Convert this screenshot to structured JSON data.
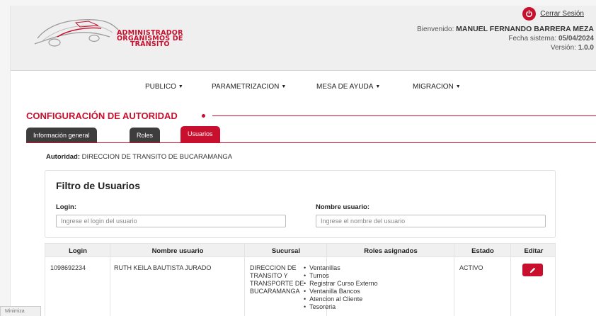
{
  "logo": {
    "line1": "ADMINISTRADOR",
    "line2": "ORGANISMOS DE",
    "line3": "TRÁNSITO",
    "icon": "car-logo-icon"
  },
  "user": {
    "logout_label": "Cerrar Sesión",
    "welcome_label": "Bienvenido:",
    "welcome_name": "MANUEL FERNANDO BARRERA MEZA",
    "date_label": "Fecha sistema:",
    "date_value": "05/04/2024",
    "version_label": "Versión:",
    "version_value": "1.0.0"
  },
  "nav": {
    "items": [
      {
        "label": "PUBLICO"
      },
      {
        "label": "PARAMETRIZACION"
      },
      {
        "label": "MESA DE AYUDA"
      },
      {
        "label": "MIGRACION"
      }
    ]
  },
  "section_title": "CONFIGURACIÓN DE AUTORIDAD",
  "tabs": [
    {
      "label": "Información general",
      "active": false
    },
    {
      "label": "Roles",
      "active": false
    },
    {
      "label": "Usuarios",
      "active": true
    }
  ],
  "autoridad": {
    "label": "Autoridad:",
    "value": "DIRECCION DE TRANSITO DE BUCARAMANGA"
  },
  "filter": {
    "title": "Filtro de Usuarios",
    "login_label": "Login:",
    "login_placeholder": "Ingrese el login del usuario",
    "login_value": "",
    "name_label": "Nombre usuario:",
    "name_placeholder": "Ingrese el nombre del usuario",
    "name_value": ""
  },
  "table": {
    "headers": [
      "Login",
      "Nombre usuario",
      "Sucursal",
      "Roles asignados",
      "Estado",
      "Editar"
    ],
    "rows": [
      {
        "login": "1098692234",
        "nombre": "RUTH KEILA BAUTISTA JURADO",
        "sucursal": [
          "DIRECCION DE",
          "TRANSITO Y",
          "TRANSPORTE DE",
          "BUCARAMANGA"
        ],
        "roles": [
          "Ventanillas",
          "Turnos",
          "Registrar Curso Externo",
          "Ventanilla Bancos",
          "Atencion al Cliente",
          "Tesoreria"
        ],
        "estado": "ACTIVO"
      }
    ]
  },
  "footer": {
    "minimize_label": "Minimiza"
  },
  "colors": {
    "accent": "#c8102e",
    "tab_dark": "#3d3d3d",
    "header_bg": "#efefef"
  }
}
